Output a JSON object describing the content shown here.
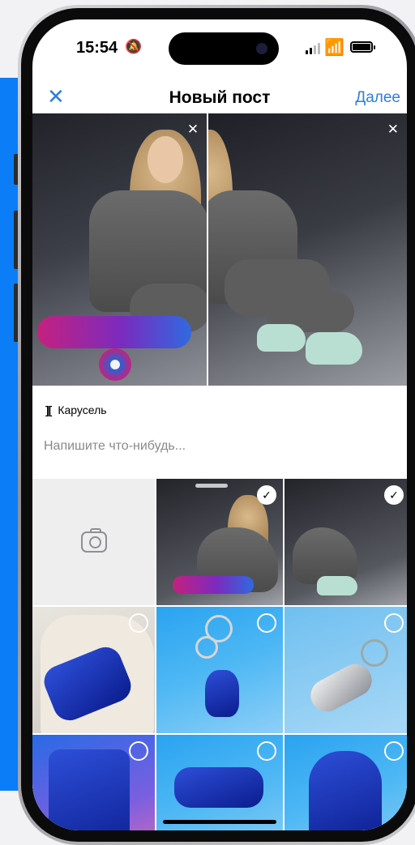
{
  "status_bar": {
    "time": "15:54",
    "mute_icon": "bell-slash-icon",
    "signal_icon": "cellular-signal-icon",
    "wifi_icon": "wifi-icon",
    "battery_icon": "battery-icon"
  },
  "navbar": {
    "close_icon": "close-icon",
    "title": "Новый пост",
    "next_label": "Далее"
  },
  "preview": {
    "items": [
      {
        "remove_icon": "close-icon"
      },
      {
        "remove_icon": "close-icon"
      }
    ]
  },
  "carousel": {
    "icon": "carousel-icon",
    "label": "Карусель"
  },
  "caption": {
    "placeholder": "Напишите что-нибудь..."
  },
  "gallery": {
    "camera_icon": "camera-icon",
    "items": [
      {
        "selected": true
      },
      {
        "selected": true
      },
      {
        "selected": false
      },
      {
        "selected": false
      },
      {
        "selected": false
      },
      {
        "selected": false
      },
      {
        "selected": false
      },
      {
        "selected": false
      }
    ]
  },
  "colors": {
    "accent": "#2b7fdc",
    "side_panel": "#0a7df7"
  }
}
